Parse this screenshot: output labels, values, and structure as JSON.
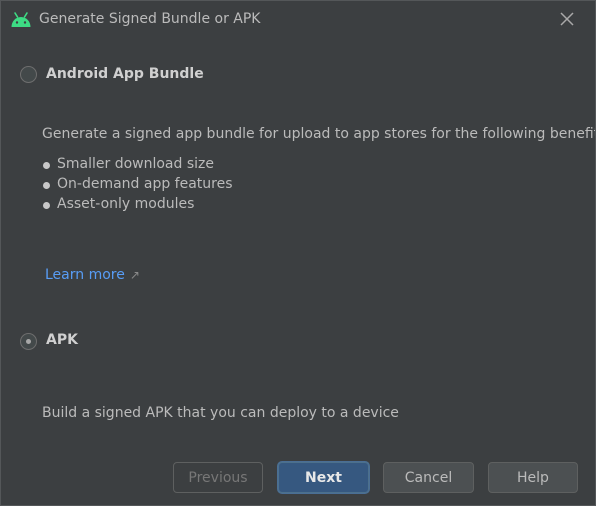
{
  "window": {
    "title": "Generate Signed Bundle or APK",
    "app_icon": "android-icon",
    "close_icon": "close-icon"
  },
  "options": {
    "bundle": {
      "label": "Android App Bundle",
      "selected": false,
      "description": "Generate a signed app bundle for upload to app stores for the following benefits:",
      "benefits": [
        "Smaller download size",
        "On-demand app features",
        "Asset-only modules"
      ],
      "learn_more": "Learn more",
      "learn_more_icon": "external-link-icon"
    },
    "apk": {
      "label": "APK",
      "selected": true,
      "description": "Build a signed APK that you can deploy to a device"
    }
  },
  "buttons": {
    "previous": "Previous",
    "next": "Next",
    "cancel": "Cancel",
    "help": "Help"
  },
  "colors": {
    "background": "#3c3f41",
    "android_green": "#3ddc84",
    "link": "#589df6",
    "primary_button": "#365880"
  }
}
